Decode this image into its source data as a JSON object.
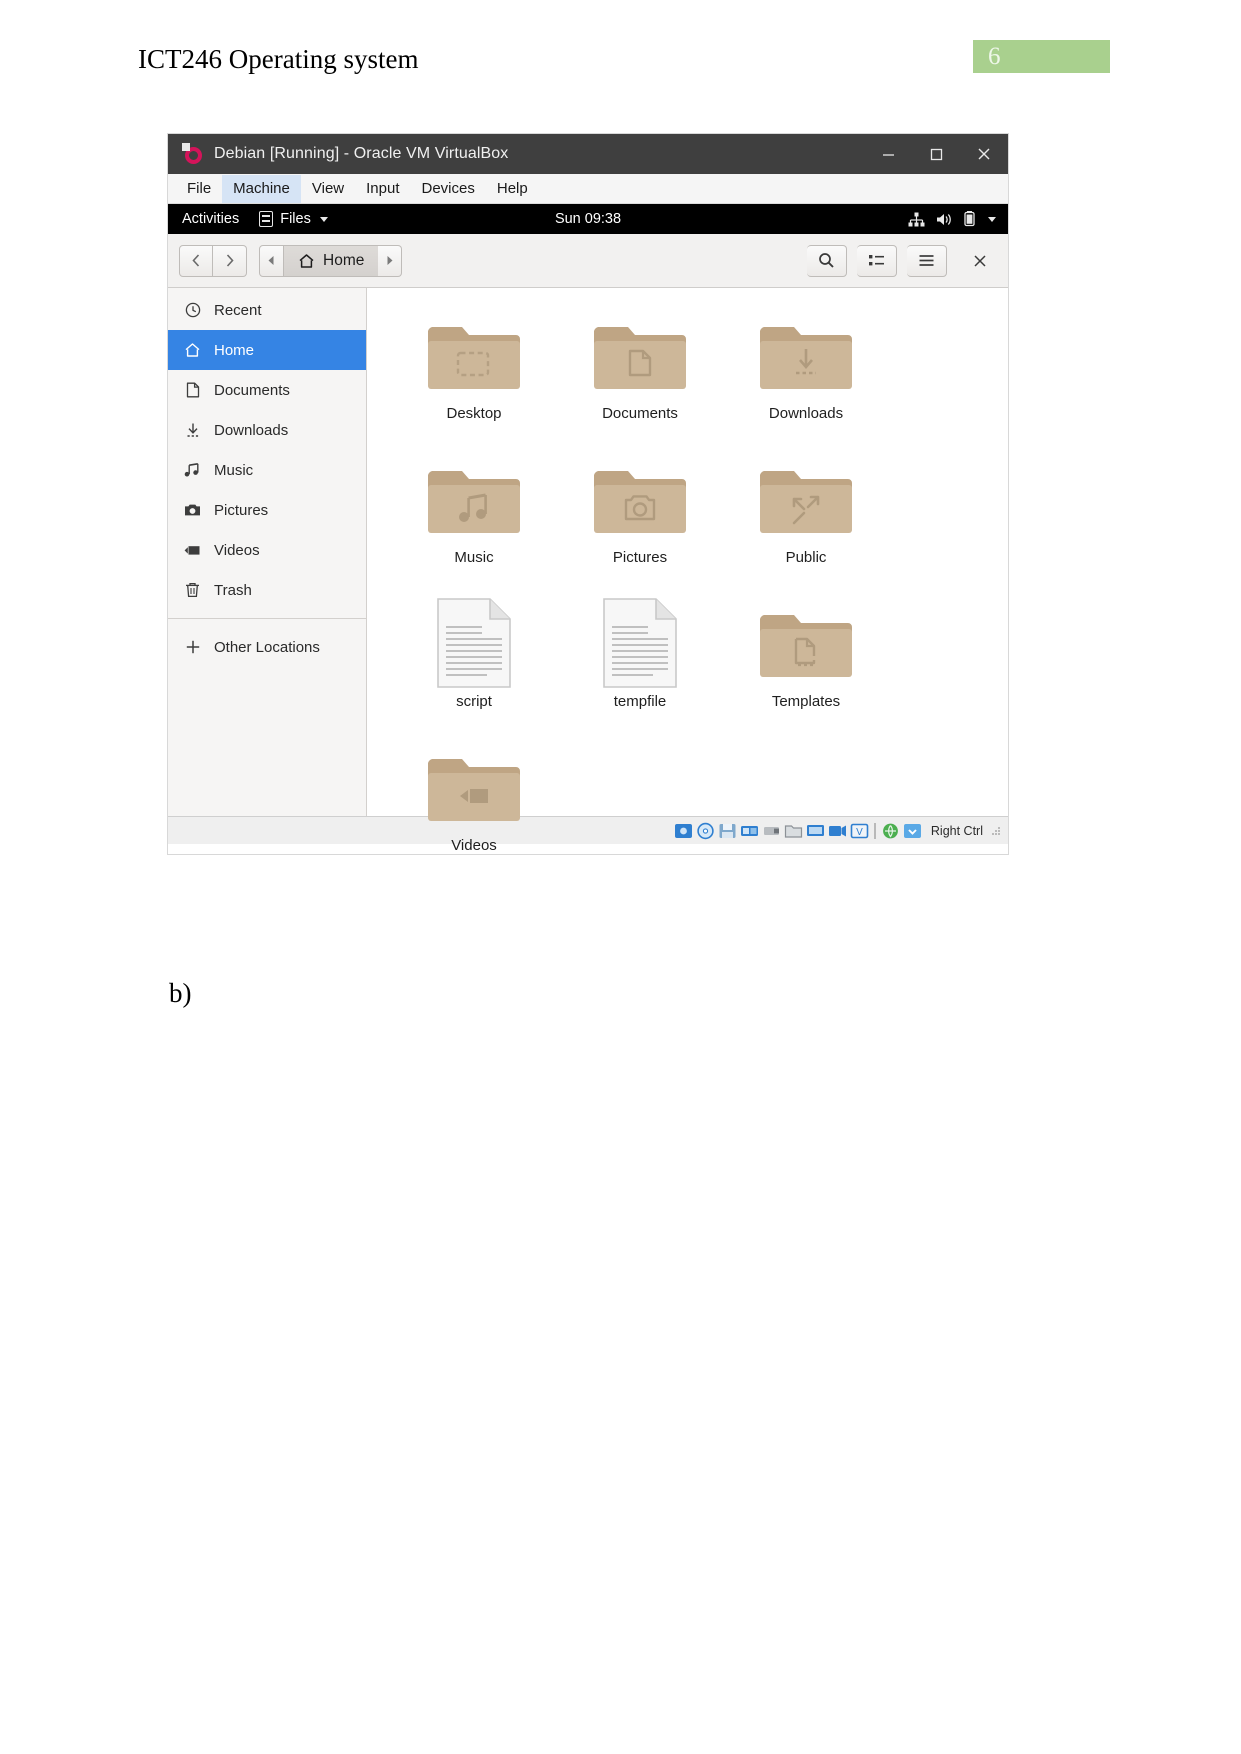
{
  "document": {
    "header_title": "ICT246 Operating system",
    "page_number": "6",
    "page_badge_color": "#a9d08e",
    "sub_label": "b)"
  },
  "vbox": {
    "titlebar": {
      "title": "Debian [Running] - Oracle VM VirtualBox",
      "logo_icon": "virtualbox-logo-icon",
      "minimize_icon": "minimize-icon",
      "maximize_icon": "maximize-icon",
      "close_icon": "close-icon"
    },
    "menubar": {
      "items": [
        {
          "label": "File",
          "active": false
        },
        {
          "label": "Machine",
          "active": true
        },
        {
          "label": "View",
          "active": false
        },
        {
          "label": "Input",
          "active": false
        },
        {
          "label": "Devices",
          "active": false
        },
        {
          "label": "Help",
          "active": false
        }
      ]
    },
    "statusbar": {
      "hint": "Right Ctrl",
      "icons": [
        "hard-disk-icon",
        "optical-disk-icon",
        "floppy-disk-icon",
        "network-icon",
        "usb-icon",
        "shared-folder-icon",
        "display-icon",
        "recording-icon",
        "virtualization-icon",
        "mouse-integration-icon",
        "host-key-icon"
      ]
    }
  },
  "gnome": {
    "activities_label": "Activities",
    "app_menu": {
      "label": "Files",
      "icon": "files-app-icon",
      "caret_icon": "chevron-down-icon"
    },
    "clock": "Sun 09:38",
    "status_icons": [
      "network-wired-icon",
      "volume-icon",
      "battery-icon",
      "chevron-down-icon"
    ]
  },
  "files": {
    "headerbar": {
      "back_icon": "chevron-left-icon",
      "forward_icon": "chevron-right-icon",
      "path_prev_icon": "triangle-left-icon",
      "path_next_icon": "triangle-right-icon",
      "current_path": "Home",
      "home_icon": "home-icon",
      "search_icon": "search-icon",
      "view_toggle_icon": "list-view-icon",
      "menu_icon": "hamburger-menu-icon",
      "close_icon": "close-icon"
    },
    "sidebar": {
      "items": [
        {
          "label": "Recent",
          "icon": "clock-icon",
          "active": false
        },
        {
          "label": "Home",
          "icon": "home-icon",
          "active": true
        },
        {
          "label": "Documents",
          "icon": "document-icon",
          "active": false
        },
        {
          "label": "Downloads",
          "icon": "download-icon",
          "active": false
        },
        {
          "label": "Music",
          "icon": "music-note-icon",
          "active": false
        },
        {
          "label": "Pictures",
          "icon": "camera-icon",
          "active": false
        },
        {
          "label": "Videos",
          "icon": "video-icon",
          "active": false
        },
        {
          "label": "Trash",
          "icon": "trash-icon",
          "active": false
        }
      ],
      "other_locations": {
        "label": "Other Locations",
        "icon": "plus-icon"
      }
    },
    "items": [
      {
        "name": "Desktop",
        "type": "folder",
        "glyph": "desktop"
      },
      {
        "name": "Documents",
        "type": "folder",
        "glyph": "document"
      },
      {
        "name": "Downloads",
        "type": "folder",
        "glyph": "download"
      },
      {
        "name": "Music",
        "type": "folder",
        "glyph": "music"
      },
      {
        "name": "Pictures",
        "type": "folder",
        "glyph": "camera"
      },
      {
        "name": "Public",
        "type": "folder",
        "glyph": "share"
      },
      {
        "name": "script",
        "type": "file",
        "glyph": "text"
      },
      {
        "name": "tempfile",
        "type": "file",
        "glyph": "text"
      },
      {
        "name": "Templates",
        "type": "folder",
        "glyph": "template"
      },
      {
        "name": "Videos",
        "type": "folder",
        "glyph": "video"
      }
    ]
  },
  "colors": {
    "sidebar_selection": "#3584e4",
    "folder_fill": "#c9b293",
    "folder_top": "#bfa584",
    "titlebar": "#3f3f3f",
    "topbar": "#000000"
  }
}
